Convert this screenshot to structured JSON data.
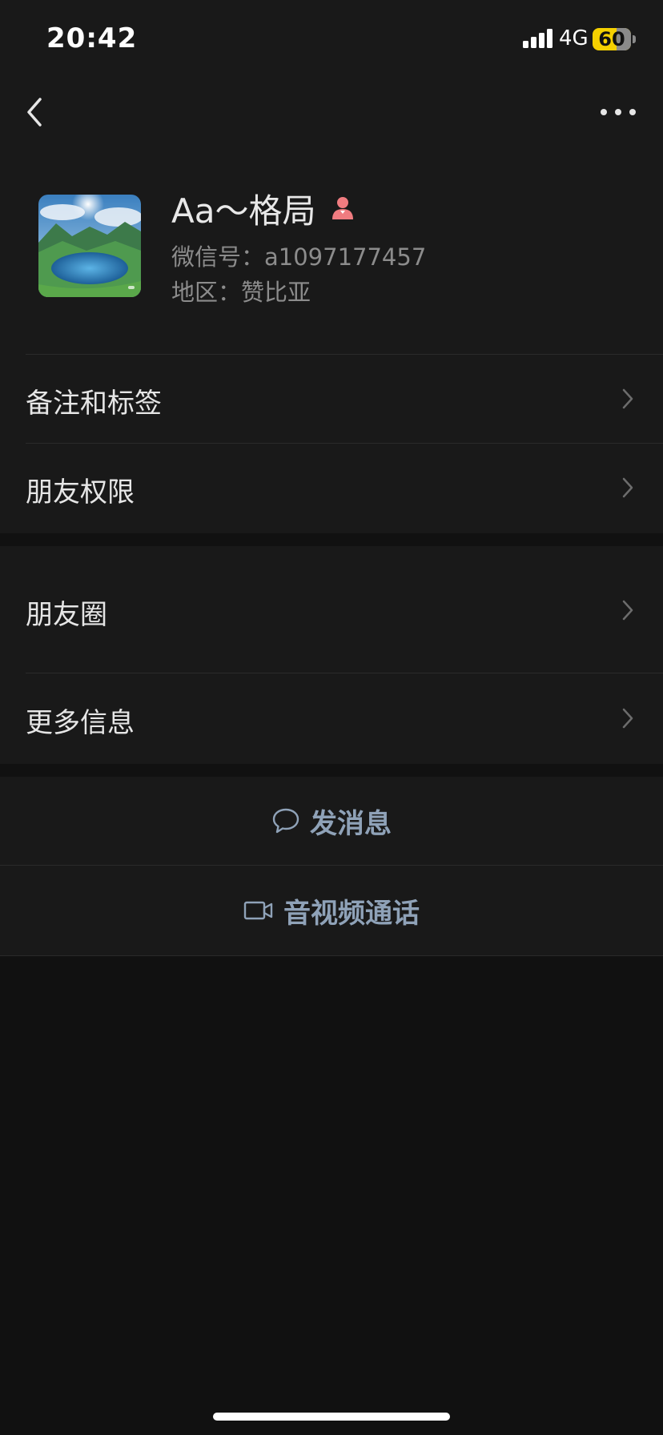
{
  "status_bar": {
    "time": "20:42",
    "network": "4G",
    "battery": "60",
    "battery_color": "#f5d000"
  },
  "nav": {
    "back_icon": "chevron-left-icon",
    "more_icon": "ellipsis-icon"
  },
  "profile": {
    "name": "Aa～格局",
    "gender_icon": "female-icon",
    "gender_color": "#f07c80",
    "wechat_id_label": "微信号：a1097177457",
    "region_label": "地区：赞比亚"
  },
  "list": {
    "remarks": "备注和标签",
    "permissions": "朋友权限",
    "moments": "朋友圈",
    "more_info": "更多信息"
  },
  "actions": {
    "message": "发消息",
    "message_icon": "chat-bubble-icon",
    "call": "音视频通话",
    "call_icon": "video-camera-icon",
    "accent_color": "#8fa2b8"
  }
}
